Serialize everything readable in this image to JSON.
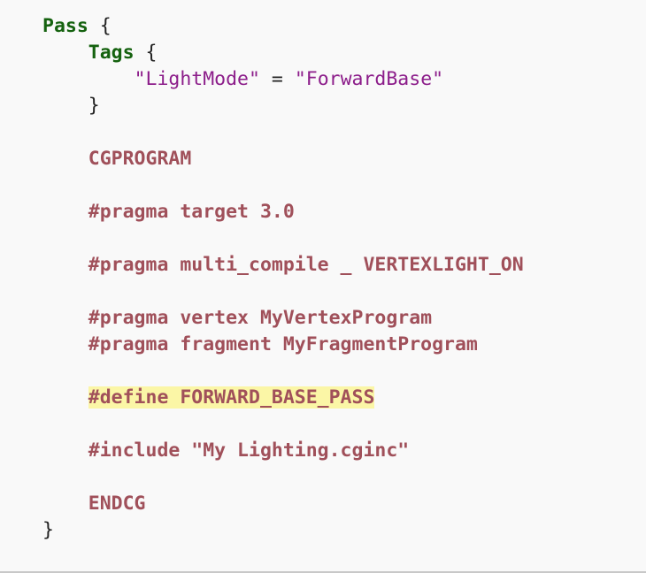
{
  "code": {
    "pass_keyword": "Pass",
    "open_brace": "{",
    "close_brace": "}",
    "tags_keyword": "Tags",
    "lightmode_key": "\"LightMode\"",
    "equals": "=",
    "lightmode_value": "\"ForwardBase\"",
    "cgprogram": "CGPROGRAM",
    "pragma_target": "#pragma target 3.0",
    "pragma_multi_compile": "#pragma multi_compile _ VERTEXLIGHT_ON",
    "pragma_vertex": "#pragma vertex MyVertexProgram",
    "pragma_fragment": "#pragma fragment MyFragmentProgram",
    "define_line": "#define FORWARD_BASE_PASS",
    "include_line": "#include \"My Lighting.cginc\"",
    "endcg": "ENDCG"
  },
  "colors": {
    "background": "#f9f9f9",
    "keyword": "#15620f",
    "string": "#8c1d8a",
    "macro": "#a0505a",
    "highlight": "#fbf6a6"
  }
}
